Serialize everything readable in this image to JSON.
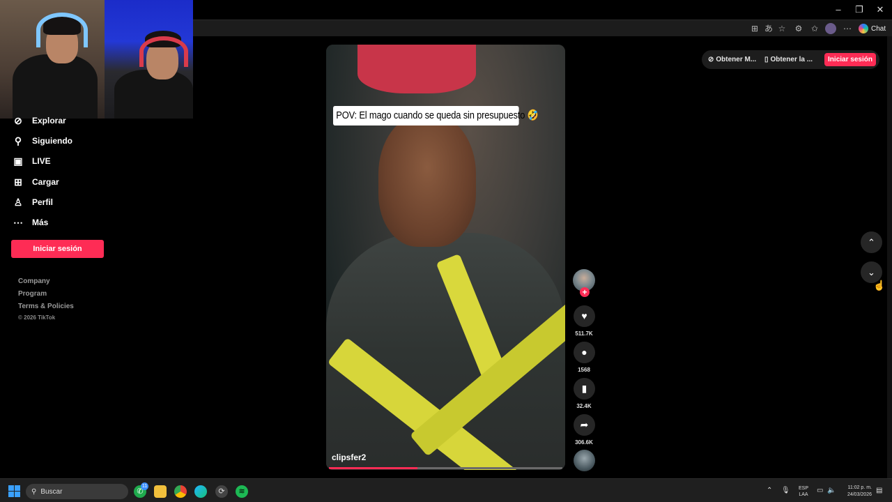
{
  "browser": {
    "window_controls": {
      "minimize": "–",
      "restore": "❐",
      "close": "✕"
    },
    "chat_label": "Chat"
  },
  "sidebar": {
    "items": [
      {
        "label": "Explorar",
        "icon": "compass-icon"
      },
      {
        "label": "Siguiendo",
        "icon": "following-icon"
      },
      {
        "label": "LIVE",
        "icon": "live-icon"
      },
      {
        "label": "Cargar",
        "icon": "upload-icon"
      },
      {
        "label": "Perfil",
        "icon": "profile-icon"
      },
      {
        "label": "Más",
        "icon": "more-icon"
      }
    ],
    "login_label": "Iniciar sesión",
    "footer_links": [
      "Company",
      "Program",
      "Terms & Policies"
    ],
    "copyright": "© 2026 TikTok"
  },
  "header": {
    "link1": "Obtener M...",
    "link2": "Obtener la ...",
    "login_label": "Iniciar sesión"
  },
  "video": {
    "caption": "POV: El mago cuando se queda sin presupuesto 🤣",
    "author": "clipsfer2",
    "progress": 0.38
  },
  "actions": {
    "likes": "511.7K",
    "comments": "1568",
    "saves": "32.4K",
    "shares": "306.6K"
  },
  "taskbar": {
    "search_placeholder": "Buscar",
    "whatsapp_badge": "11",
    "lang_line1": "ESP",
    "lang_line2": "LAA",
    "time": "11:02 p. m.",
    "date": "24/03/2026"
  },
  "colors": {
    "accent": "#fe2c55",
    "background": "#000000",
    "action_button": "#262626"
  }
}
